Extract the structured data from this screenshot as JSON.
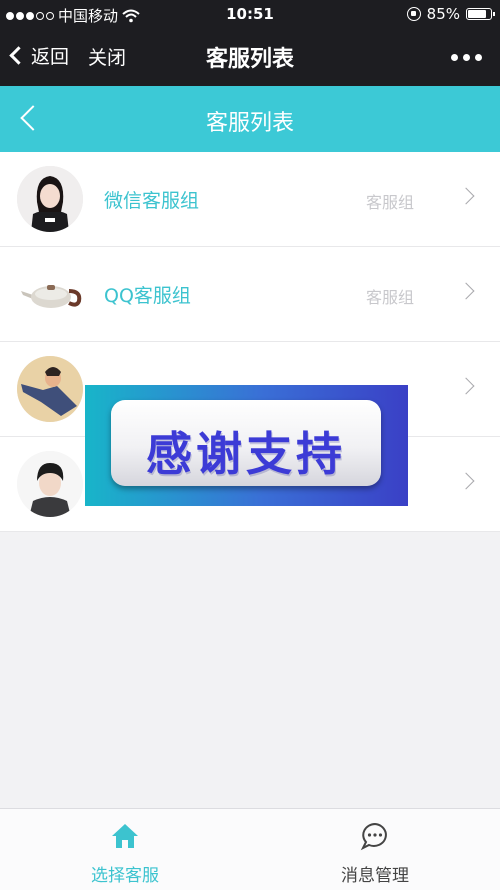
{
  "status_bar": {
    "carrier": "中国移动",
    "time": "10:51",
    "battery": "85%",
    "battery_level": 0.85
  },
  "wechat_nav": {
    "back_label": "返回",
    "close_label": "关闭",
    "title": "客服列表"
  },
  "header": {
    "title": "客服列表"
  },
  "list": {
    "items": [
      {
        "name": "微信客服组",
        "type": "客服组",
        "avatar": "avatar-girl"
      },
      {
        "name": "QQ客服组",
        "type": "客服组",
        "avatar": "avatar-teapot"
      },
      {
        "name": "",
        "type": "",
        "avatar": "avatar-painting"
      },
      {
        "name": "",
        "type": "",
        "avatar": "avatar-boy"
      }
    ]
  },
  "banner": {
    "text": "感谢支持"
  },
  "tabbar": {
    "tabs": [
      {
        "label": "选择客服",
        "icon": "home-icon",
        "active": true
      },
      {
        "label": "消息管理",
        "icon": "chat-bubble-icon",
        "active": false
      }
    ]
  },
  "colors": {
    "accent": "#3cc9d6",
    "nav_bg": "#1d1d21",
    "banner_text": "#3c3bd6"
  }
}
